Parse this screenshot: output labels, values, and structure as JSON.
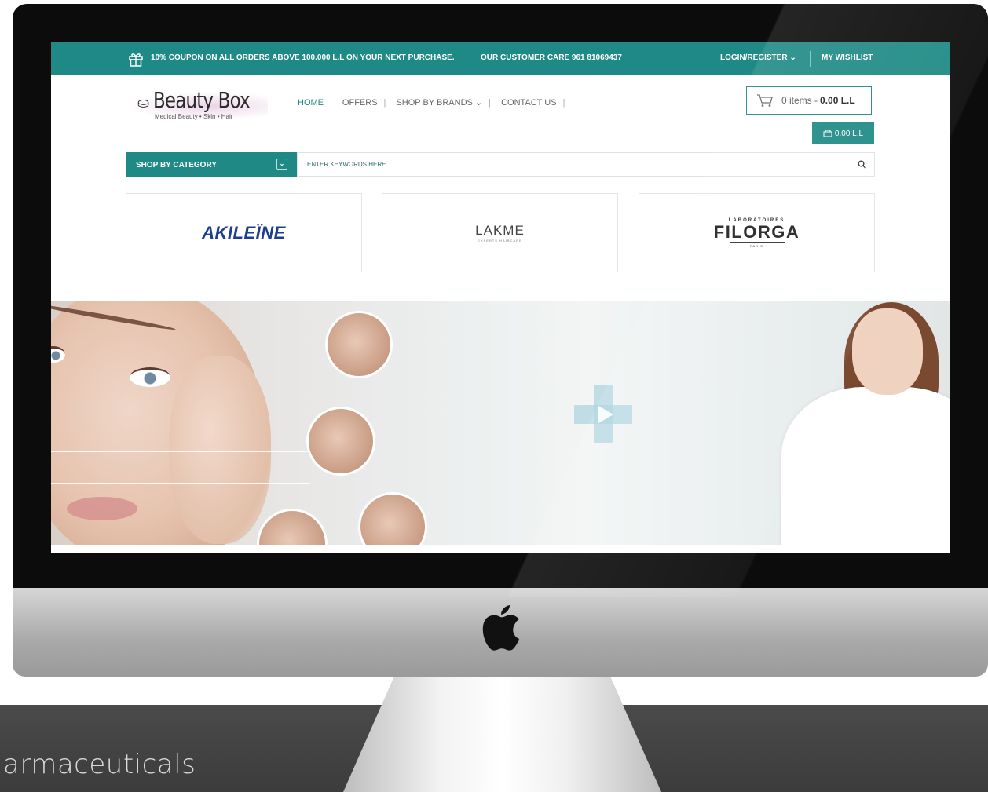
{
  "topbar": {
    "coupon": "10% COUPON ON ALL ORDERS ABOVE 100.000 L.L ON YOUR NEXT PURCHASE.",
    "care": "OUR CUSTOMER CARE 961 81069437",
    "login": "LOGIN/REGISTER ⌄",
    "wishlist": "MY WISHLIST"
  },
  "logo": {
    "brand": "Beauty Box",
    "tagline": "Medical Beauty • Skin • Hair"
  },
  "nav": {
    "home": "HOME",
    "offers": "OFFERS",
    "brands": "SHOP BY BRANDS ⌄",
    "contact": "CONTACT US"
  },
  "cart": {
    "items": "0 items -",
    "total": "0.00 L.L",
    "button_total": "0.00 L.L"
  },
  "search": {
    "category": "SHOP BY CATEGORY",
    "placeholder": "ENTER KEYWORDS HERE ..."
  },
  "brands": {
    "akileine": "AKILEÏNE",
    "lakme": "LAKMĒ",
    "lakme_sub": "EXPERTS HAIRCARE",
    "filorga_top": "LABORATOIRES",
    "filorga": "FILORGA",
    "filorga_bottom": "PARIS"
  },
  "footer": {
    "text": "armaceuticals"
  },
  "colors": {
    "accent": "#1f8a85",
    "akileine": "#1e3f8e"
  }
}
